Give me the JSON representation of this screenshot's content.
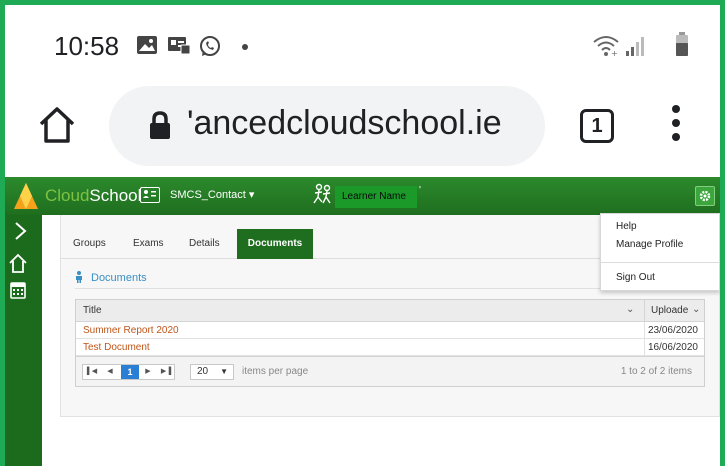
{
  "status_bar": {
    "time": "10:58",
    "icons": [
      "image-icon",
      "contact-card-icon",
      "whatsapp-icon",
      "dot-icon",
      "wifi-icon",
      "signal-icon",
      "battery-icon"
    ]
  },
  "browser": {
    "url_display": "'ancedcloudschool.ie",
    "tab_count": "1"
  },
  "app": {
    "logo_part1": "Cloud",
    "logo_part2": "School",
    "contact_label": "SMCS_Contact ▾",
    "learner_name": "Learner Name",
    "learner_caret": "'",
    "accent_color": "#1f6e1f",
    "link_color": "#c0561a"
  },
  "tabs": [
    {
      "label": "Groups",
      "active": false
    },
    {
      "label": "Exams",
      "active": false
    },
    {
      "label": "Details",
      "active": false
    },
    {
      "label": "Documents",
      "active": true
    }
  ],
  "section": {
    "title": "Documents"
  },
  "grid": {
    "columns": [
      "Title",
      "Uploade"
    ],
    "rows": [
      {
        "title": "Summer Report 2020",
        "uploaded": "23/06/2020"
      },
      {
        "title": "Test Document",
        "uploaded": "16/06/2020"
      }
    ]
  },
  "pager": {
    "current_page": "1",
    "page_size": "20",
    "items_per_page_label": "items per page",
    "count_label": "1 to 2 of 2 items"
  },
  "user_menu": {
    "items": [
      "Help",
      "Manage Profile",
      "Sign Out"
    ]
  }
}
